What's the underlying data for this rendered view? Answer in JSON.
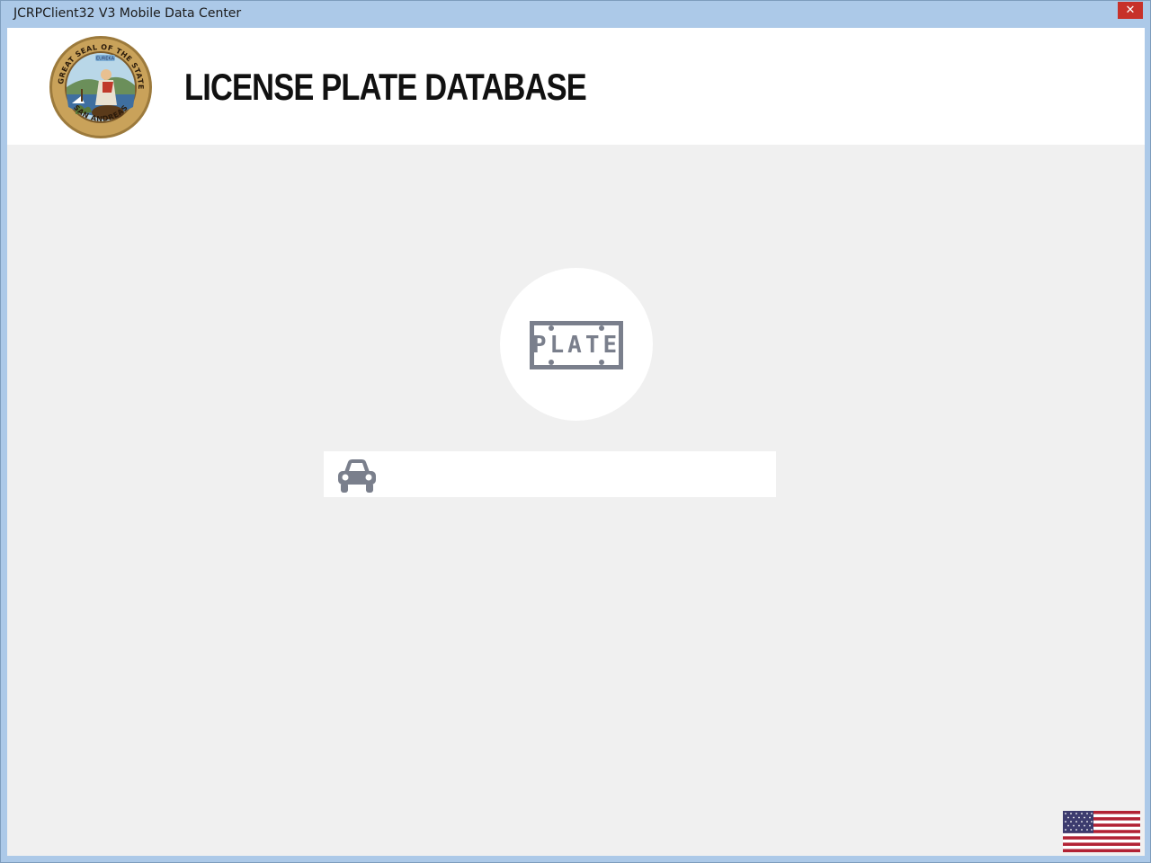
{
  "window": {
    "title": "JCRPClient32 V3 Mobile Data Center",
    "close_label": "✕"
  },
  "header": {
    "title": "License Plate Database",
    "seal": {
      "top_text": "THE GREAT SEAL OF THE STATE OF",
      "bottom_text": "SAN ANDREAS",
      "motto": "EUREKA"
    }
  },
  "main": {
    "plate_icon_text": "PLATE",
    "search": {
      "value": "",
      "placeholder": ""
    }
  },
  "colors": {
    "titlebar": "#acc9e8",
    "close_button": "#c7312a",
    "content_bg": "#f0f0f0",
    "icon_gray": "#7a7f8c"
  },
  "icons": {
    "plate": "license-plate-icon",
    "car": "car-icon",
    "flag": "us-flag-icon",
    "seal": "state-seal-icon"
  }
}
